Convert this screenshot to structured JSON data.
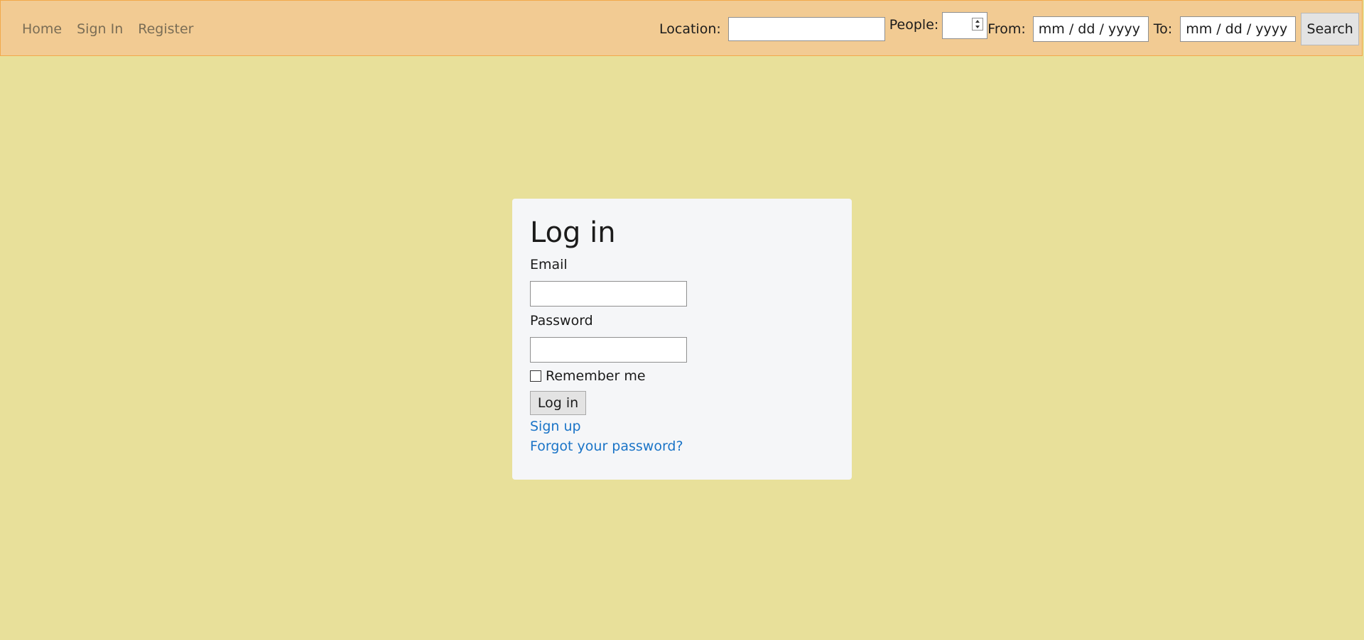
{
  "nav": {
    "links": [
      "Home",
      "Sign In",
      "Register"
    ]
  },
  "search": {
    "location_label": "Location:",
    "location_value": "",
    "people_label": "People:",
    "people_value": "",
    "from_label": "From:",
    "from_value": "mm / dd / yyyy",
    "to_label": "To:",
    "to_value": "mm / dd / yyyy",
    "button_label": "Search"
  },
  "login": {
    "title": "Log in",
    "email_label": "Email",
    "email_value": "",
    "password_label": "Password",
    "password_value": "",
    "remember_label": "Remember me",
    "remember_checked": false,
    "submit_label": "Log in",
    "signup_link": "Sign up",
    "forgot_link": "Forgot your password?"
  },
  "colors": {
    "page_background": "#e8e09a",
    "navbar_background": "#f2cb93",
    "navbar_border": "#f2a94a",
    "card_background": "#f5f6f8",
    "link": "#1a74c7",
    "nav_link": "#7a6d55"
  }
}
